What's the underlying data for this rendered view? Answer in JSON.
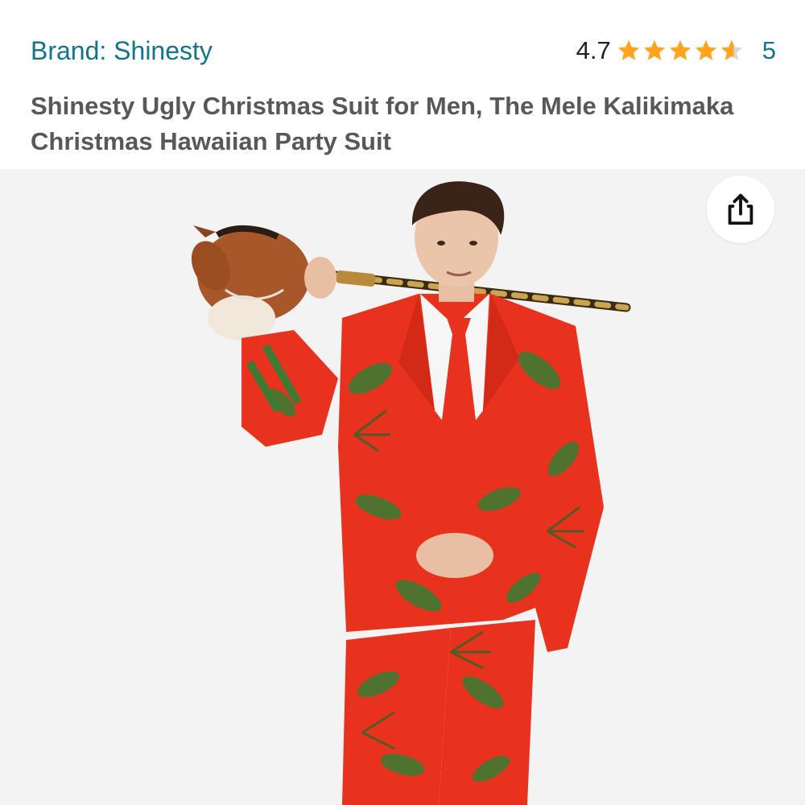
{
  "product": {
    "brand_label": "Brand: Shinesty",
    "rating_value": "4.7",
    "rating_fraction": 0.94,
    "rating_count": "5",
    "title": "Shinesty Ugly Christmas Suit for Men, The Mele Kalikimaka Christmas Hawaiian Party Suit"
  },
  "icons": {
    "star": "star-icon",
    "share": "share-icon"
  },
  "colors": {
    "link": "#127589",
    "star": "#FFA41C",
    "star_empty": "#d5d9d9",
    "suit_red": "#e8321e",
    "leaf_green": "#3f7a32",
    "image_bg": "#f3f3f3"
  }
}
